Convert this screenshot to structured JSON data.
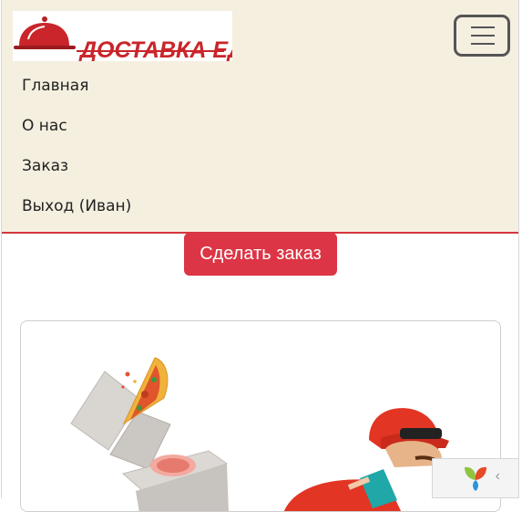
{
  "brand": {
    "logo_text": "ДОСТАВКА ЕДЫ",
    "accent_color": "#d4373e"
  },
  "navbar": {
    "items": [
      {
        "label": "Главная"
      },
      {
        "label": "О нас"
      },
      {
        "label": "Заказ"
      },
      {
        "label": "Выход (Иван)"
      }
    ],
    "toggler_icon": "hamburger-icon"
  },
  "main": {
    "order_button_label": "Сделать заказ",
    "hero_image_icon": "delivery-courier-pizza-illustration"
  },
  "widget": {
    "icon": "yii-logo-icon",
    "chevron": "‹"
  },
  "colors": {
    "navbar_bg": "#f5efe0",
    "primary_button": "#dc3545",
    "text": "#222222"
  }
}
